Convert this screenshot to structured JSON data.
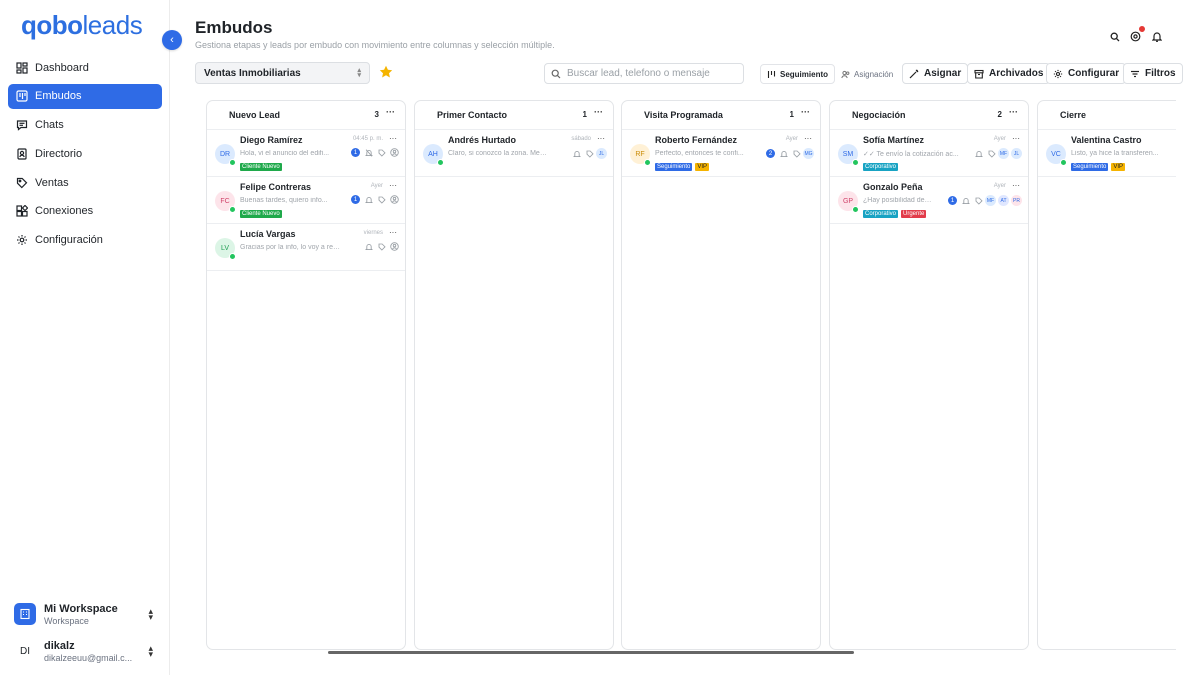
{
  "app": {
    "logo_main": "qobo",
    "logo_accent": "leads"
  },
  "sidebar": {
    "items": [
      {
        "label": "Dashboard",
        "icon": "dashboard-icon"
      },
      {
        "label": "Embudos",
        "icon": "funnel-icon",
        "active": true
      },
      {
        "label": "Chats",
        "icon": "chat-icon"
      },
      {
        "label": "Directorio",
        "icon": "contacts-icon"
      },
      {
        "label": "Ventas",
        "icon": "tag-icon"
      },
      {
        "label": "Conexiones",
        "icon": "apps-icon"
      },
      {
        "label": "Configuración",
        "icon": "gear-icon"
      }
    ],
    "workspace": {
      "name": "Mi Workspace",
      "type": "Workspace"
    },
    "user": {
      "initials": "DI",
      "name": "dikalz",
      "email": "dikalzeeuu@gmail.c..."
    }
  },
  "header": {
    "title": "Embudos",
    "subtitle": "Gestiona etapas y leads por embudo con movimiento entre columnas y selección múltiple."
  },
  "toolbar": {
    "pipeline_select": "Ventas Inmobiliarias",
    "search_placeholder": "Buscar lead, telefono o mensaje",
    "view_follow": "Seguimiento",
    "view_assign": "Asignación",
    "assign": "Asignar",
    "archived": "Archivados",
    "configure": "Configurar",
    "filters": "Filtros"
  },
  "colors": {
    "accent": "#2f6be6",
    "whatsapp": "#22c55e",
    "star": "#f5b400"
  },
  "columns": [
    {
      "title": "Nuevo Lead",
      "count": "3",
      "cards": [
        {
          "initials": "DR",
          "name": "Diego Ramírez",
          "time": "04:45 p. m.",
          "msg": "Hola, vi el anuncio del edifi...",
          "unread": "1",
          "muted": true,
          "tags": [
            {
              "label": "Cliente Nuevo",
              "color": "green"
            }
          ],
          "assignees": []
        },
        {
          "initials": "FC",
          "name": "Felipe Contreras",
          "time": "Ayer",
          "msg": "Buenas tardes, quiero info...",
          "unread": "1",
          "tags": [
            {
              "label": "Cliente Nuevo",
              "color": "green"
            }
          ],
          "assignees": []
        },
        {
          "initials": "LV",
          "name": "Lucía Vargas",
          "time": "viernes",
          "msg": "Gracias por la info, lo voy a rev...",
          "unread": "",
          "tags": [],
          "assignees": []
        }
      ]
    },
    {
      "title": "Primer Contacto",
      "count": "1",
      "cards": [
        {
          "initials": "AH",
          "name": "Andrés Hurtado",
          "time": "sábado",
          "msg": "Claro, si conozco la zona. Me v...",
          "unread": "",
          "tags": [],
          "assignees": [
            "JL"
          ]
        }
      ]
    },
    {
      "title": "Visita Programada",
      "count": "1",
      "cards": [
        {
          "initials": "RF",
          "name": "Roberto Fernández",
          "time": "Ayer",
          "msg": "Perfecto, entonces te confi...",
          "unread": "2",
          "tags": [
            {
              "label": "Seguimiento",
              "color": "blue"
            },
            {
              "label": "VIP",
              "color": "yellow"
            }
          ],
          "assignees": [
            "MG"
          ]
        }
      ]
    },
    {
      "title": "Negociación",
      "count": "2",
      "cards": [
        {
          "initials": "SM",
          "name": "Sofía Martínez",
          "time": "Ayer",
          "msg": "Te envío la cotización ac...",
          "unread": "",
          "sent": true,
          "tags": [
            {
              "label": "Corporativo",
              "color": "cyan"
            }
          ],
          "assignees": [
            "MF",
            "JL"
          ]
        },
        {
          "initials": "GP",
          "name": "Gonzalo Peña",
          "time": "Ayer",
          "msg": "¿Hay posibilidad de a...",
          "unread": "1",
          "tags": [
            {
              "label": "Corporativo",
              "color": "cyan"
            },
            {
              "label": "Urgente",
              "color": "red"
            }
          ],
          "assignees": [
            "MF",
            "AT",
            "PR"
          ]
        }
      ]
    },
    {
      "title": "Cierre",
      "count": "",
      "cards": [
        {
          "initials": "VC",
          "name": "Valentina Castro",
          "time": "",
          "msg": "Listo, ya hice la transferen...",
          "unread": "",
          "tags": [
            {
              "label": "Seguimiento",
              "color": "blue"
            },
            {
              "label": "VIP",
              "color": "yellow"
            }
          ],
          "assignees": []
        }
      ]
    }
  ]
}
